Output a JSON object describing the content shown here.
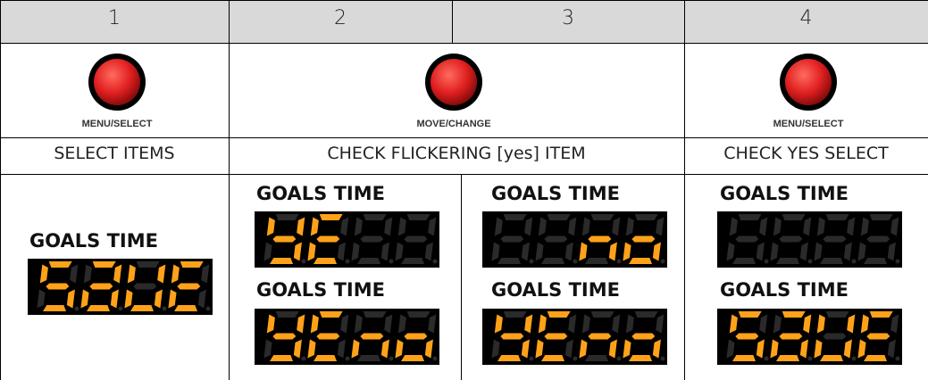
{
  "header": {
    "step1": "1",
    "step2": "2",
    "step3": "3",
    "step4": "4"
  },
  "buttons": {
    "b1": "MENU/SELECT",
    "b2": "MOVE/CHANGE",
    "b3": "MENU/SELECT"
  },
  "captions": {
    "c1": "SELECT ITEMS",
    "c2": "CHECK FLICKERING [yes] ITEM",
    "c3": "CHECK YES SELECT"
  },
  "display_label": "GOALS TIME",
  "displays": {
    "d1": "SaUE",
    "d2": "YE",
    "d3": "no",
    "d4": "YEno",
    "d5": "YEno",
    "d6": "",
    "d7": "SaUE"
  },
  "colors": {
    "header_bg": "#d9d9d9",
    "button_red": "#e02020",
    "segment_on": "#ffa21a",
    "segment_off": "#2a2a2a",
    "display_bg": "#000000"
  }
}
